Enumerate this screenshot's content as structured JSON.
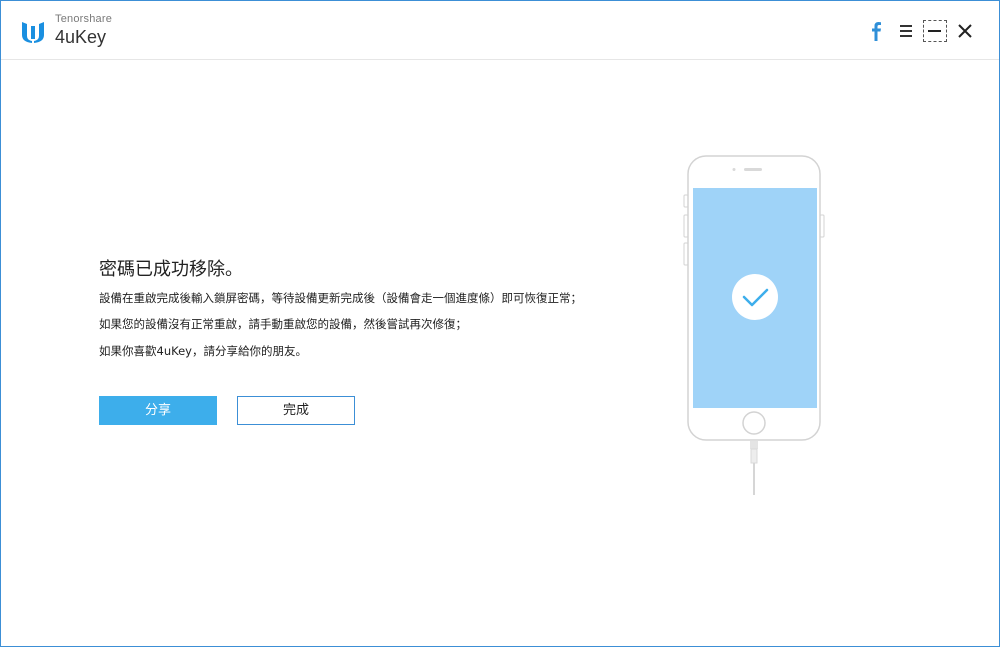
{
  "app": {
    "brand_small": "Tenorshare",
    "brand_name": "4uKey"
  },
  "window_controls": {
    "facebook_icon": "facebook-icon",
    "menu_icon": "menu-icon",
    "minimize_icon": "minimize-icon",
    "close_icon": "close-icon"
  },
  "message": {
    "title": "密碼已成功移除。",
    "lines": [
      "設備在重啟完成後輸入鎖屏密碼，等待設備更新完成後（設備會走一個進度條）即可恢復正常；",
      "如果您的設備沒有正常重啟，請手動重啟您的設備，然後嘗試再次修復；",
      "如果你喜歡4uKey，請分享給你的朋友。"
    ]
  },
  "buttons": {
    "share": "分享",
    "done": "完成"
  },
  "colors": {
    "accent": "#3daeeb",
    "border": "#3c8fd6",
    "screen": "#9fd3f8"
  }
}
